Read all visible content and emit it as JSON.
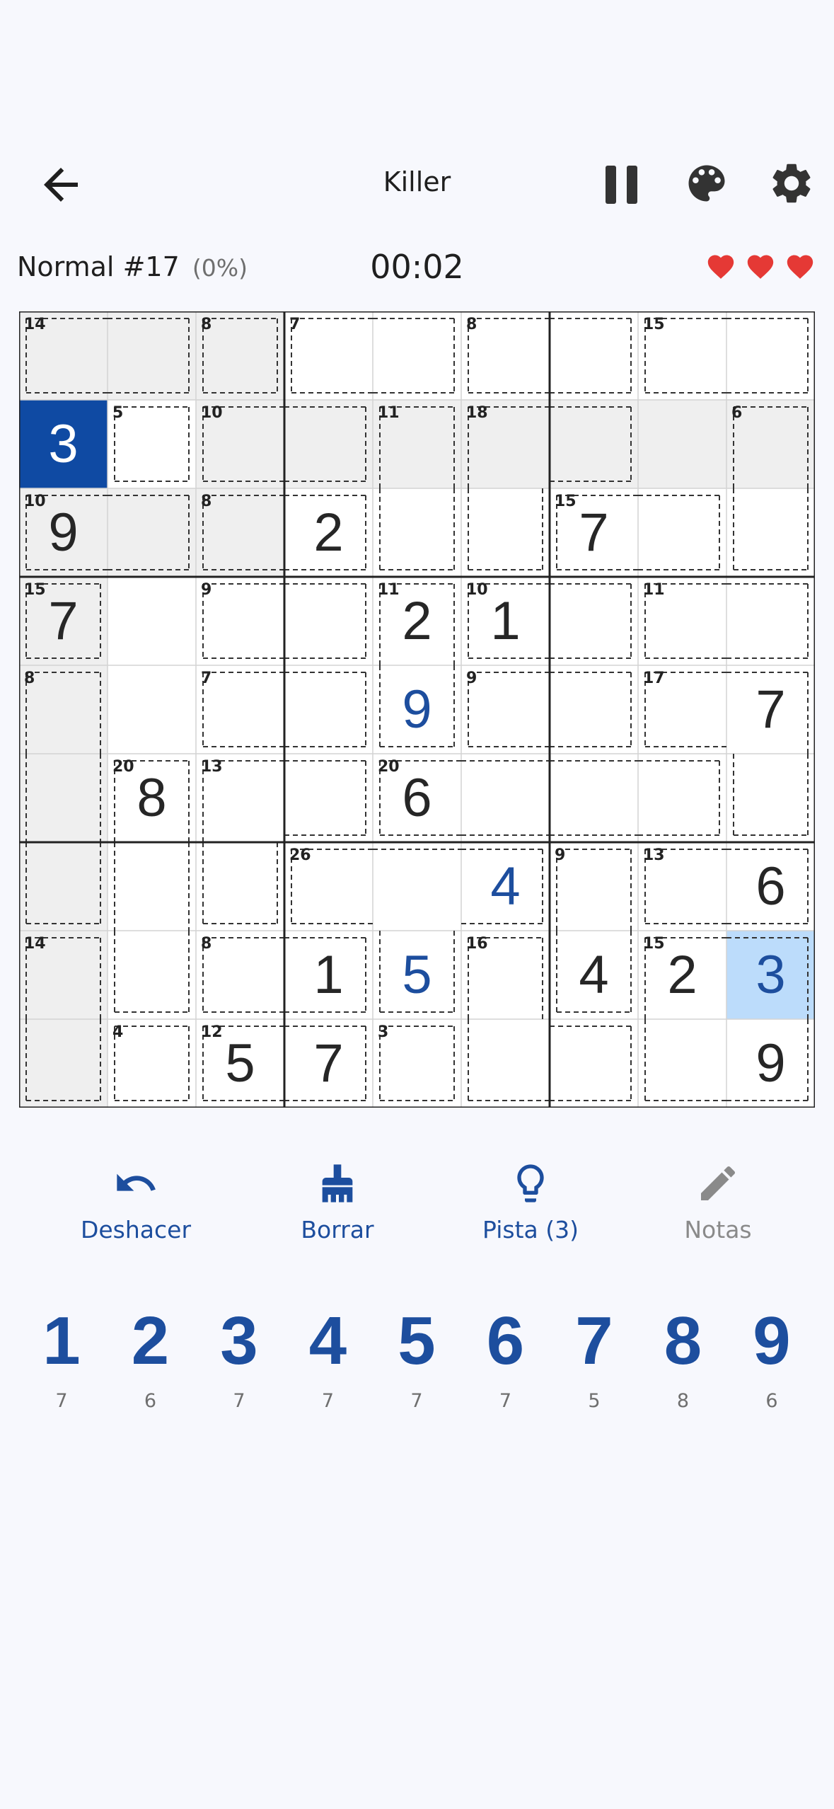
{
  "header": {
    "title": "Killer",
    "difficulty": "Normal #17",
    "progress": "(0%)",
    "timer": "00:02",
    "lives": 3,
    "heart_color": "#e53935"
  },
  "colors": {
    "accent": "#1d4e9e",
    "selected_cell": "#0f4aa3",
    "highlight_cell": "#bcdcfb",
    "related_cell": "#efefef"
  },
  "grid": {
    "values": [
      [
        0,
        0,
        0,
        0,
        0,
        0,
        0,
        0,
        0
      ],
      [
        3,
        0,
        0,
        0,
        0,
        0,
        0,
        0,
        0
      ],
      [
        9,
        0,
        0,
        2,
        0,
        0,
        7,
        0,
        0
      ],
      [
        7,
        0,
        0,
        0,
        2,
        1,
        0,
        0,
        0
      ],
      [
        0,
        0,
        0,
        0,
        9,
        0,
        0,
        0,
        7
      ],
      [
        0,
        8,
        0,
        0,
        6,
        0,
        0,
        0,
        0
      ],
      [
        0,
        0,
        0,
        0,
        0,
        4,
        0,
        0,
        6
      ],
      [
        0,
        0,
        0,
        1,
        5,
        0,
        4,
        2,
        3
      ],
      [
        0,
        0,
        5,
        7,
        0,
        0,
        0,
        0,
        9
      ]
    ],
    "user_entered": [
      [
        4,
        4
      ],
      [
        6,
        5
      ],
      [
        7,
        4
      ],
      [
        7,
        8
      ]
    ],
    "selected": [
      1,
      0
    ],
    "highlighted": [
      [
        7,
        8
      ]
    ],
    "related": [
      [
        0,
        0
      ],
      [
        0,
        1
      ],
      [
        0,
        2
      ],
      [
        1,
        2
      ],
      [
        1,
        3
      ],
      [
        1,
        4
      ],
      [
        1,
        5
      ],
      [
        1,
        6
      ],
      [
        1,
        7
      ],
      [
        1,
        8
      ],
      [
        2,
        0
      ],
      [
        2,
        1
      ],
      [
        2,
        2
      ],
      [
        3,
        0
      ],
      [
        4,
        0
      ],
      [
        5,
        0
      ],
      [
        6,
        0
      ],
      [
        7,
        0
      ],
      [
        8,
        0
      ]
    ],
    "cages": [
      {
        "sum": "14",
        "cells": [
          [
            0,
            0
          ],
          [
            0,
            1
          ]
        ]
      },
      {
        "sum": "8",
        "cells": [
          [
            0,
            2
          ]
        ]
      },
      {
        "sum": "7",
        "cells": [
          [
            0,
            3
          ],
          [
            0,
            4
          ]
        ]
      },
      {
        "sum": "8",
        "cells": [
          [
            0,
            5
          ],
          [
            0,
            6
          ]
        ]
      },
      {
        "sum": "15",
        "cells": [
          [
            0,
            7
          ],
          [
            0,
            8
          ]
        ]
      },
      {
        "sum": "5",
        "cells": [
          [
            1,
            1
          ]
        ]
      },
      {
        "sum": "10",
        "cells": [
          [
            1,
            2
          ],
          [
            1,
            3
          ]
        ]
      },
      {
        "sum": "11",
        "cells": [
          [
            1,
            4
          ],
          [
            2,
            4
          ]
        ]
      },
      {
        "sum": "18",
        "cells": [
          [
            1,
            5
          ],
          [
            1,
            6
          ],
          [
            2,
            5
          ]
        ]
      },
      {
        "sum": "6",
        "cells": [
          [
            1,
            8
          ],
          [
            2,
            8
          ]
        ]
      },
      {
        "sum": "10",
        "cells": [
          [
            2,
            0
          ],
          [
            2,
            1
          ]
        ]
      },
      {
        "sum": "8",
        "cells": [
          [
            2,
            2
          ],
          [
            2,
            3
          ]
        ]
      },
      {
        "sum": "15",
        "cells": [
          [
            2,
            6
          ],
          [
            2,
            7
          ]
        ]
      },
      {
        "sum": "15",
        "cells": [
          [
            3,
            0
          ]
        ]
      },
      {
        "sum": "9",
        "cells": [
          [
            3,
            2
          ],
          [
            3,
            3
          ]
        ]
      },
      {
        "sum": "11",
        "cells": [
          [
            3,
            4
          ],
          [
            4,
            4
          ]
        ]
      },
      {
        "sum": "10",
        "cells": [
          [
            3,
            5
          ],
          [
            3,
            6
          ]
        ]
      },
      {
        "sum": "11",
        "cells": [
          [
            3,
            7
          ],
          [
            3,
            8
          ]
        ]
      },
      {
        "sum": "8",
        "cells": [
          [
            4,
            0
          ],
          [
            5,
            0
          ],
          [
            6,
            0
          ]
        ]
      },
      {
        "sum": "7",
        "cells": [
          [
            4,
            2
          ],
          [
            4,
            3
          ]
        ]
      },
      {
        "sum": "9",
        "cells": [
          [
            4,
            5
          ],
          [
            4,
            6
          ]
        ]
      },
      {
        "sum": "17",
        "cells": [
          [
            4,
            7
          ],
          [
            4,
            8
          ],
          [
            5,
            8
          ]
        ]
      },
      {
        "sum": "20",
        "cells": [
          [
            5,
            1
          ],
          [
            6,
            1
          ],
          [
            7,
            1
          ]
        ]
      },
      {
        "sum": "13",
        "cells": [
          [
            5,
            2
          ],
          [
            5,
            3
          ],
          [
            6,
            2
          ]
        ]
      },
      {
        "sum": "20",
        "cells": [
          [
            5,
            4
          ],
          [
            5,
            5
          ],
          [
            5,
            6
          ],
          [
            5,
            7
          ]
        ]
      },
      {
        "sum": "26",
        "cells": [
          [
            6,
            3
          ],
          [
            6,
            4
          ],
          [
            6,
            5
          ],
          [
            7,
            4
          ]
        ]
      },
      {
        "sum": "9",
        "cells": [
          [
            6,
            6
          ],
          [
            7,
            6
          ]
        ]
      },
      {
        "sum": "13",
        "cells": [
          [
            6,
            7
          ],
          [
            6,
            8
          ]
        ]
      },
      {
        "sum": "14",
        "cells": [
          [
            7,
            0
          ],
          [
            8,
            0
          ]
        ]
      },
      {
        "sum": "8",
        "cells": [
          [
            7,
            2
          ],
          [
            7,
            3
          ]
        ]
      },
      {
        "sum": "16",
        "cells": [
          [
            7,
            5
          ],
          [
            8,
            5
          ],
          [
            8,
            6
          ]
        ]
      },
      {
        "sum": "15",
        "cells": [
          [
            7,
            7
          ],
          [
            7,
            8
          ],
          [
            8,
            7
          ],
          [
            8,
            8
          ]
        ]
      },
      {
        "sum": "4",
        "cells": [
          [
            8,
            1
          ]
        ]
      },
      {
        "sum": "12",
        "cells": [
          [
            8,
            2
          ],
          [
            8,
            3
          ]
        ]
      },
      {
        "sum": "3",
        "cells": [
          [
            8,
            4
          ]
        ]
      }
    ]
  },
  "tools": [
    {
      "label": "Deshacer",
      "icon": "undo-icon",
      "enabled": true
    },
    {
      "label": "Borrar",
      "icon": "brush-icon",
      "enabled": true
    },
    {
      "label": "Pista (3)",
      "icon": "lightbulb-icon",
      "enabled": true
    },
    {
      "label": "Notas",
      "icon": "pencil-icon",
      "enabled": false
    }
  ],
  "numpad": [
    {
      "digit": "1",
      "remaining": "7"
    },
    {
      "digit": "2",
      "remaining": "6"
    },
    {
      "digit": "3",
      "remaining": "7"
    },
    {
      "digit": "4",
      "remaining": "7"
    },
    {
      "digit": "5",
      "remaining": "7"
    },
    {
      "digit": "6",
      "remaining": "7"
    },
    {
      "digit": "7",
      "remaining": "5"
    },
    {
      "digit": "8",
      "remaining": "8"
    },
    {
      "digit": "9",
      "remaining": "6"
    }
  ]
}
